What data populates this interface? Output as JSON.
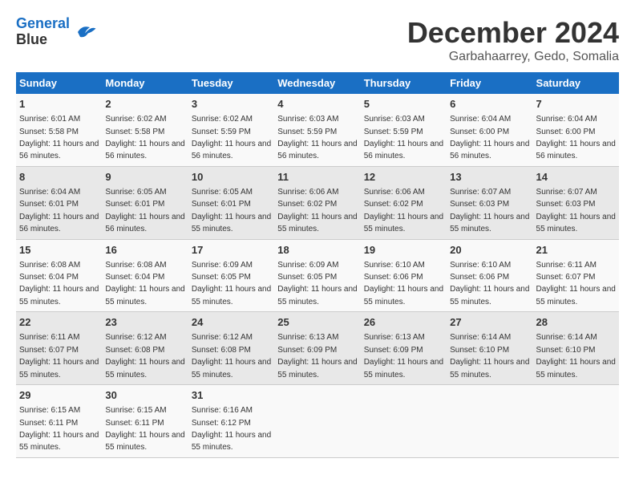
{
  "logo": {
    "line1": "General",
    "line2": "Blue"
  },
  "title": "December 2024",
  "location": "Garbahaarrey, Gedo, Somalia",
  "headers": [
    "Sunday",
    "Monday",
    "Tuesday",
    "Wednesday",
    "Thursday",
    "Friday",
    "Saturday"
  ],
  "weeks": [
    [
      {
        "day": "1",
        "sunrise": "6:01 AM",
        "sunset": "5:58 PM",
        "daylight": "11 hours and 56 minutes."
      },
      {
        "day": "2",
        "sunrise": "6:02 AM",
        "sunset": "5:58 PM",
        "daylight": "11 hours and 56 minutes."
      },
      {
        "day": "3",
        "sunrise": "6:02 AM",
        "sunset": "5:59 PM",
        "daylight": "11 hours and 56 minutes."
      },
      {
        "day": "4",
        "sunrise": "6:03 AM",
        "sunset": "5:59 PM",
        "daylight": "11 hours and 56 minutes."
      },
      {
        "day": "5",
        "sunrise": "6:03 AM",
        "sunset": "5:59 PM",
        "daylight": "11 hours and 56 minutes."
      },
      {
        "day": "6",
        "sunrise": "6:04 AM",
        "sunset": "6:00 PM",
        "daylight": "11 hours and 56 minutes."
      },
      {
        "day": "7",
        "sunrise": "6:04 AM",
        "sunset": "6:00 PM",
        "daylight": "11 hours and 56 minutes."
      }
    ],
    [
      {
        "day": "8",
        "sunrise": "6:04 AM",
        "sunset": "6:01 PM",
        "daylight": "11 hours and 56 minutes."
      },
      {
        "day": "9",
        "sunrise": "6:05 AM",
        "sunset": "6:01 PM",
        "daylight": "11 hours and 56 minutes."
      },
      {
        "day": "10",
        "sunrise": "6:05 AM",
        "sunset": "6:01 PM",
        "daylight": "11 hours and 55 minutes."
      },
      {
        "day": "11",
        "sunrise": "6:06 AM",
        "sunset": "6:02 PM",
        "daylight": "11 hours and 55 minutes."
      },
      {
        "day": "12",
        "sunrise": "6:06 AM",
        "sunset": "6:02 PM",
        "daylight": "11 hours and 55 minutes."
      },
      {
        "day": "13",
        "sunrise": "6:07 AM",
        "sunset": "6:03 PM",
        "daylight": "11 hours and 55 minutes."
      },
      {
        "day": "14",
        "sunrise": "6:07 AM",
        "sunset": "6:03 PM",
        "daylight": "11 hours and 55 minutes."
      }
    ],
    [
      {
        "day": "15",
        "sunrise": "6:08 AM",
        "sunset": "6:04 PM",
        "daylight": "11 hours and 55 minutes."
      },
      {
        "day": "16",
        "sunrise": "6:08 AM",
        "sunset": "6:04 PM",
        "daylight": "11 hours and 55 minutes."
      },
      {
        "day": "17",
        "sunrise": "6:09 AM",
        "sunset": "6:05 PM",
        "daylight": "11 hours and 55 minutes."
      },
      {
        "day": "18",
        "sunrise": "6:09 AM",
        "sunset": "6:05 PM",
        "daylight": "11 hours and 55 minutes."
      },
      {
        "day": "19",
        "sunrise": "6:10 AM",
        "sunset": "6:06 PM",
        "daylight": "11 hours and 55 minutes."
      },
      {
        "day": "20",
        "sunrise": "6:10 AM",
        "sunset": "6:06 PM",
        "daylight": "11 hours and 55 minutes."
      },
      {
        "day": "21",
        "sunrise": "6:11 AM",
        "sunset": "6:07 PM",
        "daylight": "11 hours and 55 minutes."
      }
    ],
    [
      {
        "day": "22",
        "sunrise": "6:11 AM",
        "sunset": "6:07 PM",
        "daylight": "11 hours and 55 minutes."
      },
      {
        "day": "23",
        "sunrise": "6:12 AM",
        "sunset": "6:08 PM",
        "daylight": "11 hours and 55 minutes."
      },
      {
        "day": "24",
        "sunrise": "6:12 AM",
        "sunset": "6:08 PM",
        "daylight": "11 hours and 55 minutes."
      },
      {
        "day": "25",
        "sunrise": "6:13 AM",
        "sunset": "6:09 PM",
        "daylight": "11 hours and 55 minutes."
      },
      {
        "day": "26",
        "sunrise": "6:13 AM",
        "sunset": "6:09 PM",
        "daylight": "11 hours and 55 minutes."
      },
      {
        "day": "27",
        "sunrise": "6:14 AM",
        "sunset": "6:10 PM",
        "daylight": "11 hours and 55 minutes."
      },
      {
        "day": "28",
        "sunrise": "6:14 AM",
        "sunset": "6:10 PM",
        "daylight": "11 hours and 55 minutes."
      }
    ],
    [
      {
        "day": "29",
        "sunrise": "6:15 AM",
        "sunset": "6:11 PM",
        "daylight": "11 hours and 55 minutes."
      },
      {
        "day": "30",
        "sunrise": "6:15 AM",
        "sunset": "6:11 PM",
        "daylight": "11 hours and 55 minutes."
      },
      {
        "day": "31",
        "sunrise": "6:16 AM",
        "sunset": "6:12 PM",
        "daylight": "11 hours and 55 minutes."
      },
      null,
      null,
      null,
      null
    ]
  ]
}
